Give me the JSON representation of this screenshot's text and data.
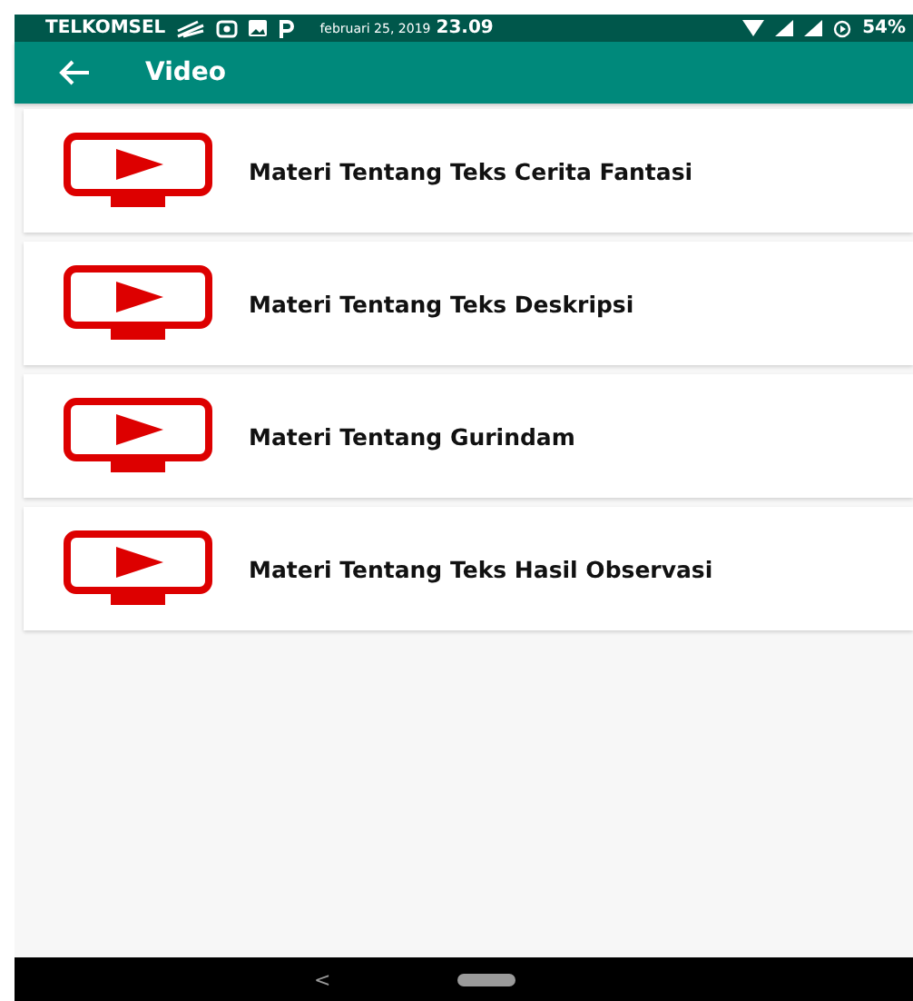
{
  "status_bar": {
    "carrier": "TELKOMSEL",
    "date": "februari 25, 2019",
    "time": "23.09",
    "battery": "54%"
  },
  "app_bar": {
    "title": "Video"
  },
  "items": [
    {
      "title": "Materi Tentang Teks Cerita Fantasi"
    },
    {
      "title": "Materi Tentang Teks Deskripsi"
    },
    {
      "title": "Materi Tentang Gurindam"
    },
    {
      "title": "Materi Tentang Teks Hasil Observasi"
    }
  ],
  "nav_bar": {
    "back": "<"
  }
}
